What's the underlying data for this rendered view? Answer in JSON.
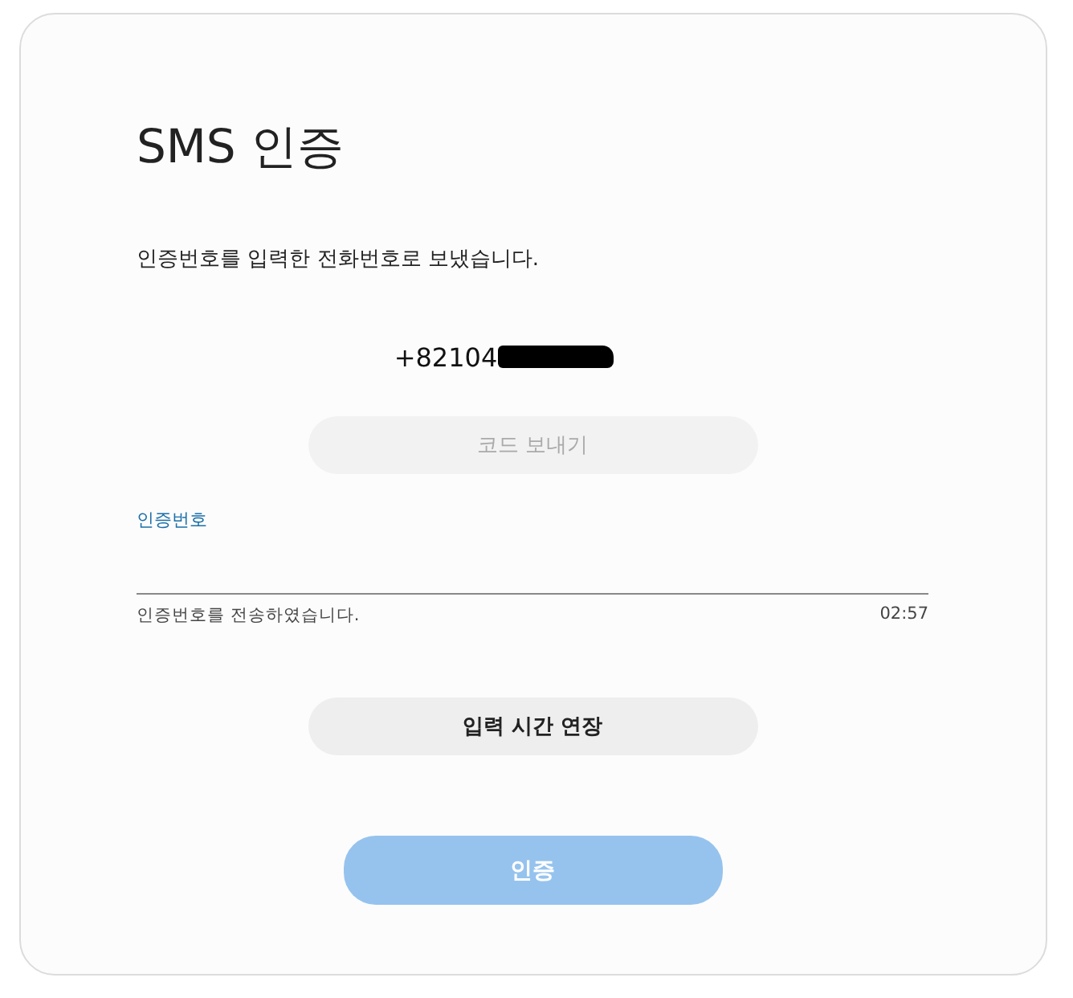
{
  "title": "SMS 인증",
  "message": "인증번호를 입력한 전화번호로 보냈습니다.",
  "phone": "+82104",
  "send_code_button": {
    "label": "코드 보내기",
    "disabled": true
  },
  "code_field": {
    "label": "인증번호",
    "focused": true
  },
  "helper_text": "인증번호를 전송하였습니다.",
  "timer": "02:57",
  "extend_button": {
    "label": "입력 시간 연장",
    "disabled": false
  },
  "verify_button": {
    "label": "인증",
    "disabled": true
  }
}
